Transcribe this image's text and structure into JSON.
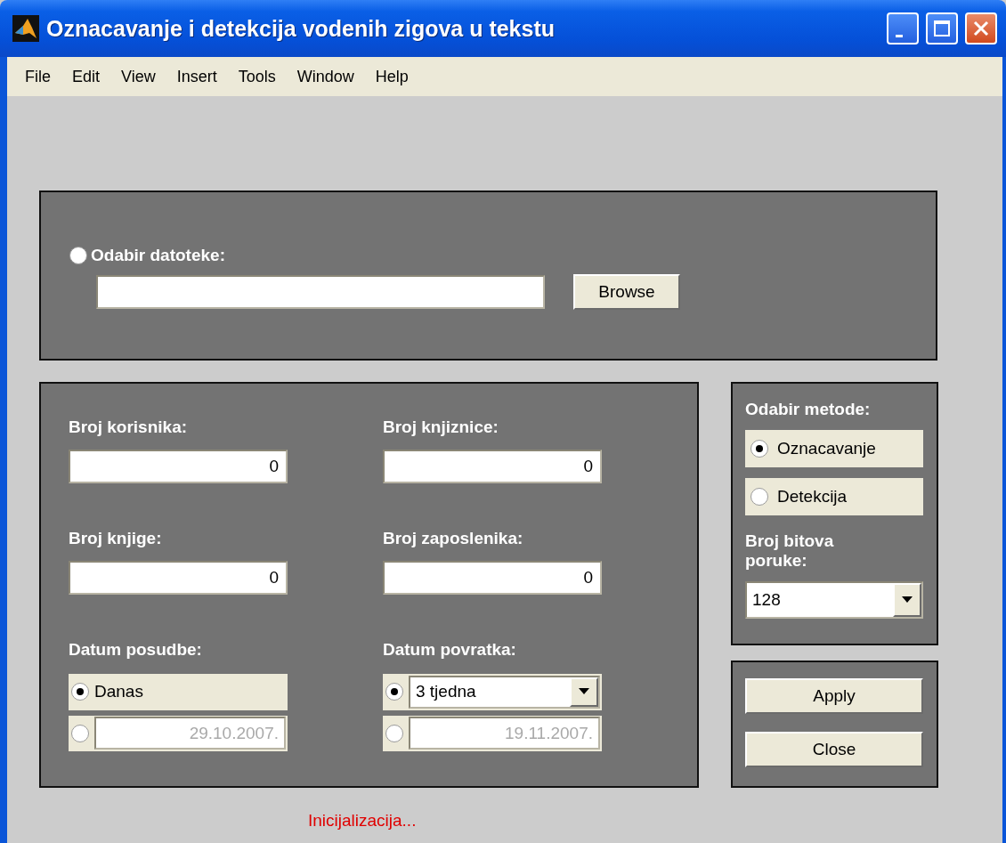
{
  "window": {
    "title": "Oznacavanje i detekcija vodenih zigova u tekstu"
  },
  "menu": [
    "File",
    "Edit",
    "View",
    "Insert",
    "Tools",
    "Window",
    "Help"
  ],
  "file_panel": {
    "label": "Odabir datoteke:",
    "selected": false,
    "button": "Browse"
  },
  "fields": [
    {
      "label": "Broj korisnika:",
      "value": "0"
    },
    {
      "label": "Broj knjiznice:",
      "value": "0"
    },
    {
      "label": "Broj knjige:",
      "value": "0"
    },
    {
      "label": "Broj zaposlenika:",
      "value": "0"
    }
  ],
  "dates": [
    {
      "label": "Datum posudbe:",
      "options": [
        {
          "kind": "text",
          "text": "Danas",
          "selected": true
        },
        {
          "kind": "date",
          "value": "29.10.2007.",
          "selected": false,
          "disabled": true
        }
      ]
    },
    {
      "label": "Datum povratka:",
      "options": [
        {
          "kind": "dropdown",
          "value": "3 tjedna",
          "selected": true
        },
        {
          "kind": "date",
          "value": "19.11.2007.",
          "selected": false,
          "disabled": true
        }
      ]
    }
  ],
  "method": {
    "label": "Odabir metode:",
    "options": [
      {
        "label": "Oznacavanje",
        "selected": true
      },
      {
        "label": "Detekcija",
        "selected": false
      }
    ]
  },
  "bits": {
    "label": "Broj bitova poruke:",
    "value": "128"
  },
  "buttons": [
    "Apply",
    "Close"
  ],
  "status": "Inicijalizacija..."
}
